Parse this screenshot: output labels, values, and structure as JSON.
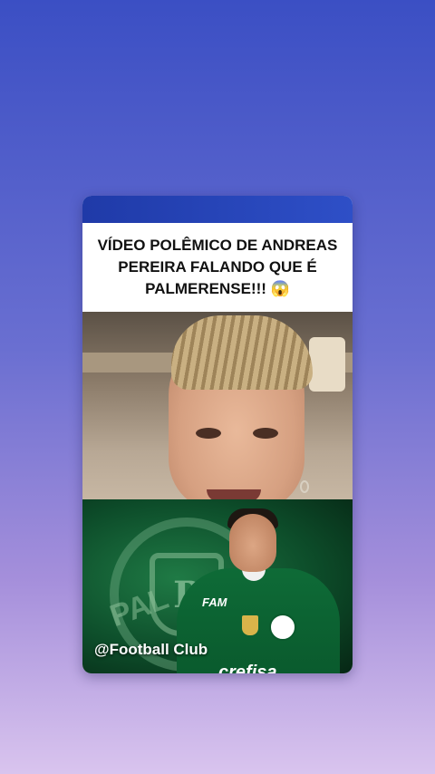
{
  "post": {
    "headline": "VÍDEO POLÊMICO DE ANDREAS PEREIRA FALANDO QUE É PALMERENSE!!! 😱",
    "watermark": "@Football Club",
    "sponsor_chest": "crefisa",
    "sponsor_top": "FAM",
    "crest_word": "PAL",
    "crest_letter": "P"
  },
  "colors": {
    "background_top": "#3b4fc4",
    "background_bottom": "#d9c4ee",
    "card_top_bar": "#1f3aa8",
    "promo_green": "#0d4d2a"
  }
}
